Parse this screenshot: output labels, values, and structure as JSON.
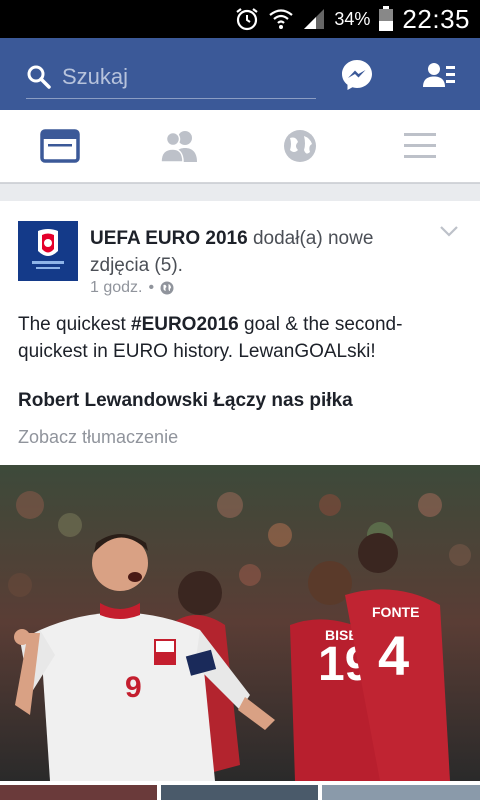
{
  "status_bar": {
    "battery_percent": "34%",
    "time": "22:35",
    "icons": [
      "alarm-icon",
      "wifi-icon",
      "signal-icon",
      "battery-icon"
    ]
  },
  "top_bar": {
    "search_placeholder": "Szukaj",
    "icons": [
      "search-icon",
      "messenger-icon",
      "friend-requests-icon"
    ],
    "color": "#3b5998"
  },
  "tabs": [
    {
      "name": "news-feed",
      "icon": "news-feed-icon",
      "active": true
    },
    {
      "name": "friends",
      "icon": "friends-icon",
      "active": false
    },
    {
      "name": "notifications",
      "icon": "globe-icon",
      "active": false
    },
    {
      "name": "more",
      "icon": "menu-icon",
      "active": false
    }
  ],
  "post": {
    "page_name": "UEFA EURO 2016",
    "action": "dodał(a) nowe zdjęcia (5).",
    "time": "1 godz.",
    "separator": "•",
    "body_before": "The quickest ",
    "body_hashtag": "#EURO2016",
    "body_after": " goal & the second-quickest in EURO history. LewanGOALski!",
    "caption": "Robert Lewandowski Łączy nas piłka",
    "translation_link": "Zobacz tłumaczenie",
    "photo_jersey_numbers": [
      "9",
      "19",
      "4"
    ],
    "photo_jersey_names": [
      "BISEU",
      "FONTE"
    ]
  }
}
